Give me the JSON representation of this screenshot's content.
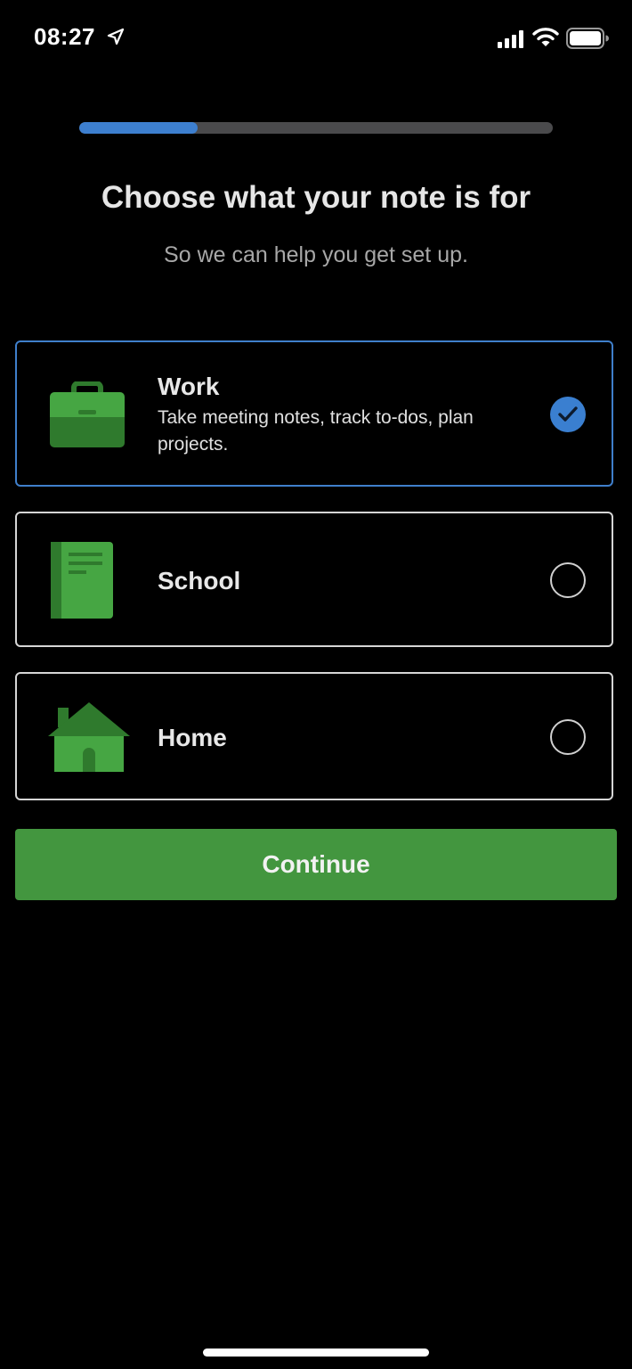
{
  "status_bar": {
    "time": "08:27",
    "icons": [
      "location-arrow-icon",
      "cellular-signal-icon",
      "wifi-icon",
      "battery-icon"
    ]
  },
  "progress": {
    "fraction": 0.25,
    "fill_color": "#3d7fcf"
  },
  "header": {
    "title": "Choose what your note is for",
    "subtitle": "So we can help you get set up."
  },
  "options": [
    {
      "label": "Work",
      "description": "Take meeting notes, track to-dos, plan projects.",
      "icon": "briefcase-icon",
      "selected": true
    },
    {
      "label": "School",
      "description": "",
      "icon": "notebook-icon",
      "selected": false
    },
    {
      "label": "Home",
      "description": "",
      "icon": "house-icon",
      "selected": false
    }
  ],
  "continue_label": "Continue",
  "colors": {
    "accent": "#3d7fcf",
    "brand_green": "#43963f",
    "background": "#000000"
  }
}
